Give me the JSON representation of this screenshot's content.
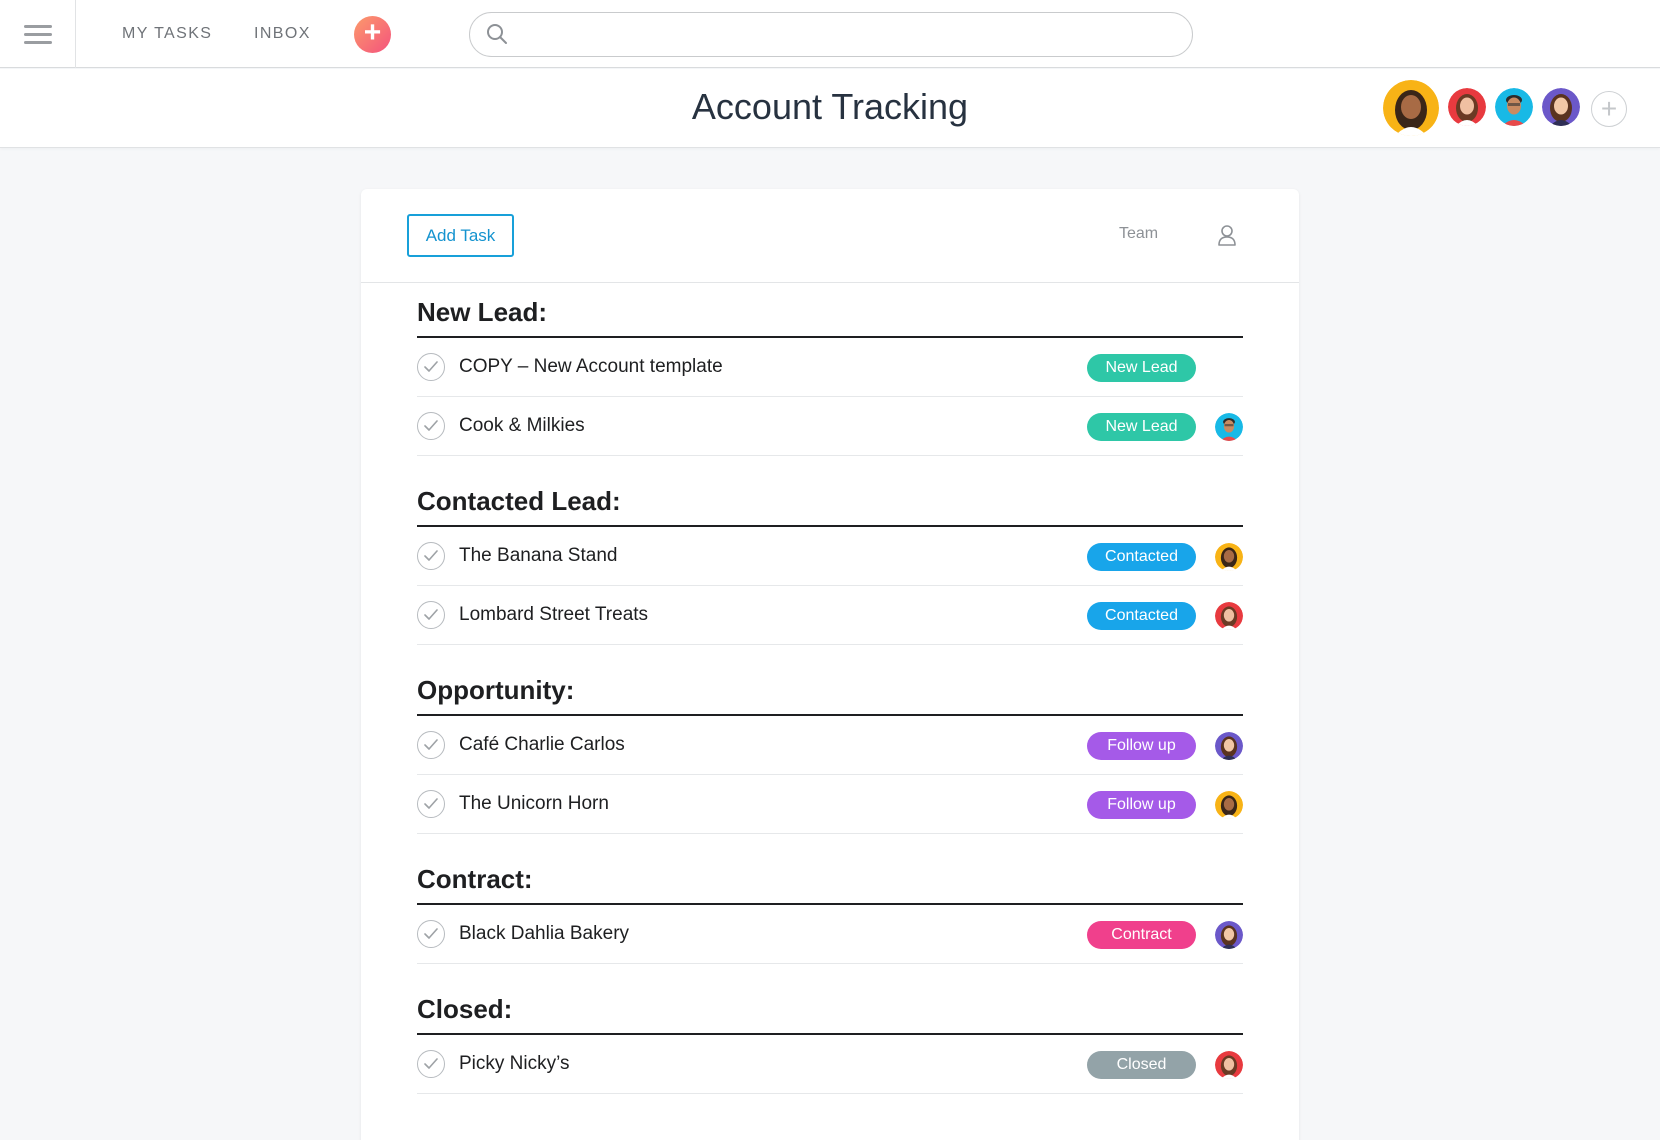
{
  "topbar": {
    "nav": [
      {
        "label": "MY TASKS"
      },
      {
        "label": "INBOX"
      }
    ],
    "search_placeholder": ""
  },
  "header": {
    "title": "Account Tracking",
    "members": [
      "avatar-woman-yellow",
      "avatar-woman-red",
      "avatar-man-cyan",
      "avatar-woman-purple"
    ]
  },
  "toolbar": {
    "add_task_label": "Add Task",
    "team_label": "Team"
  },
  "colors": {
    "new_lead": "#2ec7a7",
    "contacted": "#18a5ea",
    "follow_up": "#a55ae8",
    "contract": "#f0408c",
    "closed": "#93a3a8",
    "accent": "#18a0d9"
  },
  "sections": [
    {
      "title": "New Lead:",
      "tasks": [
        {
          "name": "COPY – New Account template",
          "tag": "New Lead",
          "assignee": ""
        },
        {
          "name": "Cook & Milkies",
          "tag": "New Lead",
          "assignee": "avatar-man-cyan"
        }
      ]
    },
    {
      "title": "Contacted Lead:",
      "tasks": [
        {
          "name": "The Banana Stand",
          "tag": "Contacted",
          "assignee": "avatar-woman-yellow"
        },
        {
          "name": "Lombard Street Treats",
          "tag": "Contacted",
          "assignee": "avatar-woman-red"
        }
      ]
    },
    {
      "title": "Opportunity:",
      "tasks": [
        {
          "name": "Café Charlie Carlos",
          "tag": "Follow up",
          "assignee": "avatar-woman-purple"
        },
        {
          "name": "The Unicorn Horn",
          "tag": "Follow up",
          "assignee": "avatar-woman-yellow"
        }
      ]
    },
    {
      "title": "Contract:",
      "tasks": [
        {
          "name": "Black Dahlia Bakery",
          "tag": "Contract",
          "assignee": "avatar-woman-purple"
        }
      ]
    },
    {
      "title": "Closed:",
      "tasks": [
        {
          "name": "Picky Nicky’s",
          "tag": "Closed",
          "assignee": "avatar-woman-red"
        }
      ]
    }
  ]
}
